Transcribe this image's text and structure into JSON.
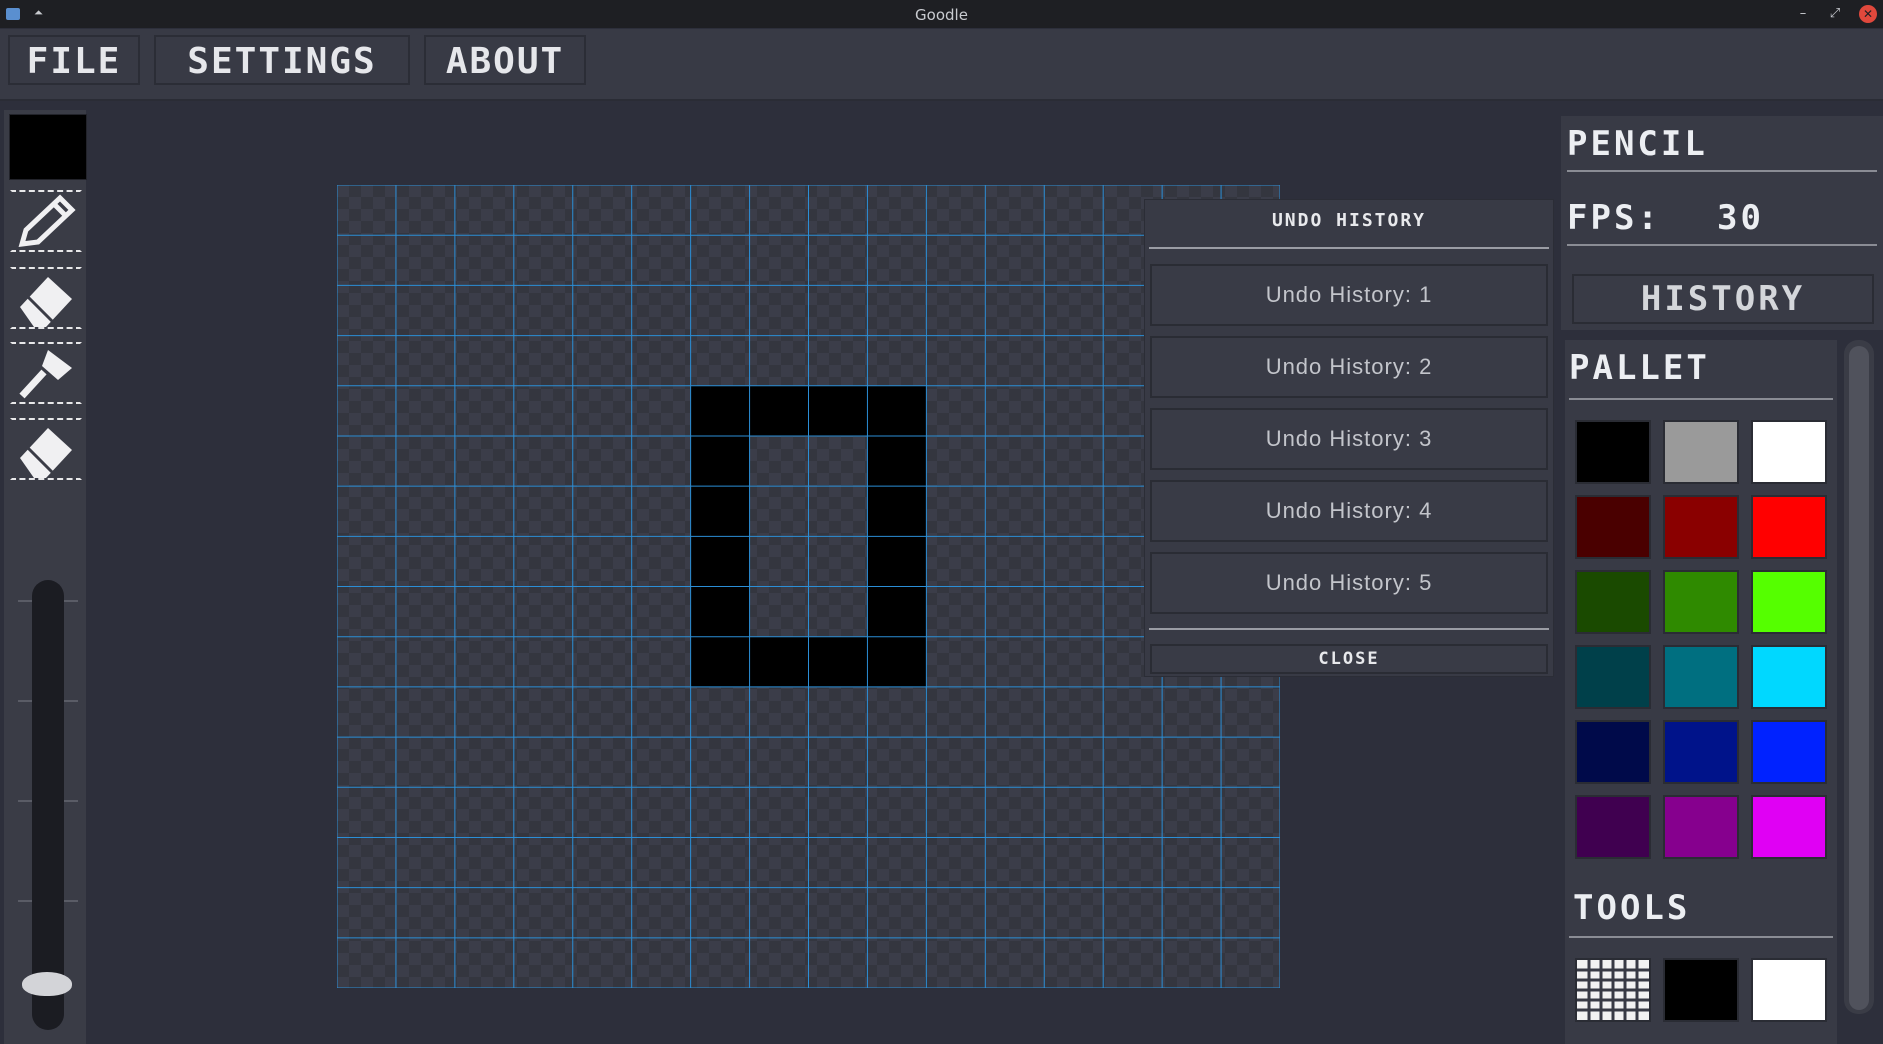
{
  "window": {
    "title": "Goodle",
    "pin_glyph": "⏶",
    "minimize_glyph": "–",
    "maximize_glyph": "⤢",
    "close_glyph": "✕"
  },
  "menu": {
    "file": "FILE",
    "settings": "SETTINGS",
    "about": "ABOUT"
  },
  "toolbar": {
    "current_color": "#000000",
    "tools": [
      "pencil-icon",
      "eraser-icon",
      "fill-bucket-icon",
      "clear-eraser-icon"
    ],
    "brush_size_fraction": 0.0
  },
  "canvas": {
    "grid_color": "#2b8ed6",
    "columns": 16,
    "rows": 16,
    "filled_cells": [
      [
        6,
        4
      ],
      [
        7,
        4
      ],
      [
        8,
        4
      ],
      [
        9,
        4
      ],
      [
        6,
        5
      ],
      [
        9,
        5
      ],
      [
        6,
        6
      ],
      [
        9,
        6
      ],
      [
        6,
        7
      ],
      [
        9,
        7
      ],
      [
        6,
        8
      ],
      [
        9,
        8
      ],
      [
        6,
        9
      ],
      [
        7,
        9
      ],
      [
        8,
        9
      ],
      [
        9,
        9
      ]
    ]
  },
  "undo_history": {
    "title": "UNDO HISTORY",
    "items": [
      "Undo History: 1",
      "Undo History: 2",
      "Undo History: 3",
      "Undo History: 4",
      "Undo History: 5"
    ],
    "close_label": "CLOSE"
  },
  "right_panel": {
    "tool_name": "PENCIL",
    "fps_label": "FPS:",
    "fps_value": "30",
    "history_button": "HISTORY",
    "pallet_title": "PALLET",
    "palette_colors": [
      "#000000",
      "#9a9a9a",
      "#ffffff",
      "#4a0000",
      "#8a0000",
      "#ff0000",
      "#1a4a00",
      "#2f8a00",
      "#55ff00",
      "#00404a",
      "#006f80",
      "#00d8ff",
      "#000a4a",
      "#00138a",
      "#0022ff",
      "#400050",
      "#86008e",
      "#e000f4"
    ],
    "tools_title": "TOOLS",
    "tools_items": [
      "grid-icon",
      "#000000",
      "#ffffff"
    ]
  }
}
